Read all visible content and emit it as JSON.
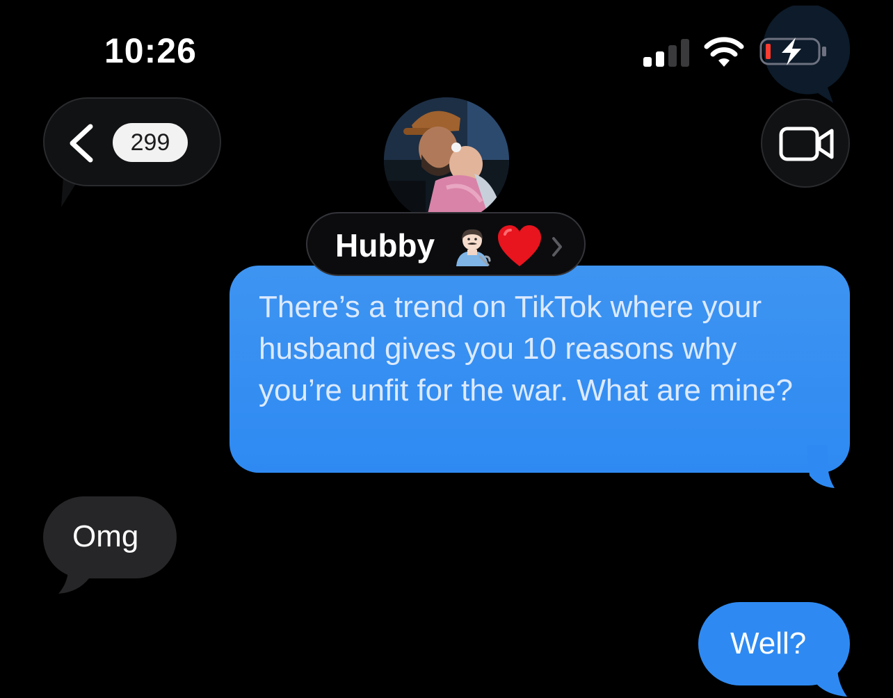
{
  "status_bar": {
    "time": "10:26",
    "icons": [
      "signal-icon",
      "wifi-icon",
      "battery-charging-icon"
    ],
    "battery_color": "#ff3b30"
  },
  "nav": {
    "back_icon": "chevron-left-icon",
    "unread_count": "299",
    "contact": {
      "name": "Hubby",
      "emoji_1": "man-mechanic-emoji",
      "emoji_2": "red-heart-emoji",
      "chevron": "chevron-right-icon"
    },
    "video_icon": "video-camera-icon"
  },
  "messages": [
    {
      "direction": "outgoing",
      "text": "There’s a trend on TikTok where your husband gives you 10 reasons why you’re unfit for the war. What are mine?"
    },
    {
      "direction": "incoming",
      "text": "Omg"
    },
    {
      "direction": "outgoing",
      "text": "Well?"
    }
  ],
  "colors": {
    "background": "#000000",
    "outgoing_bubble": "#2e8af2",
    "incoming_bubble": "#262628",
    "pill_background": "#111214"
  }
}
